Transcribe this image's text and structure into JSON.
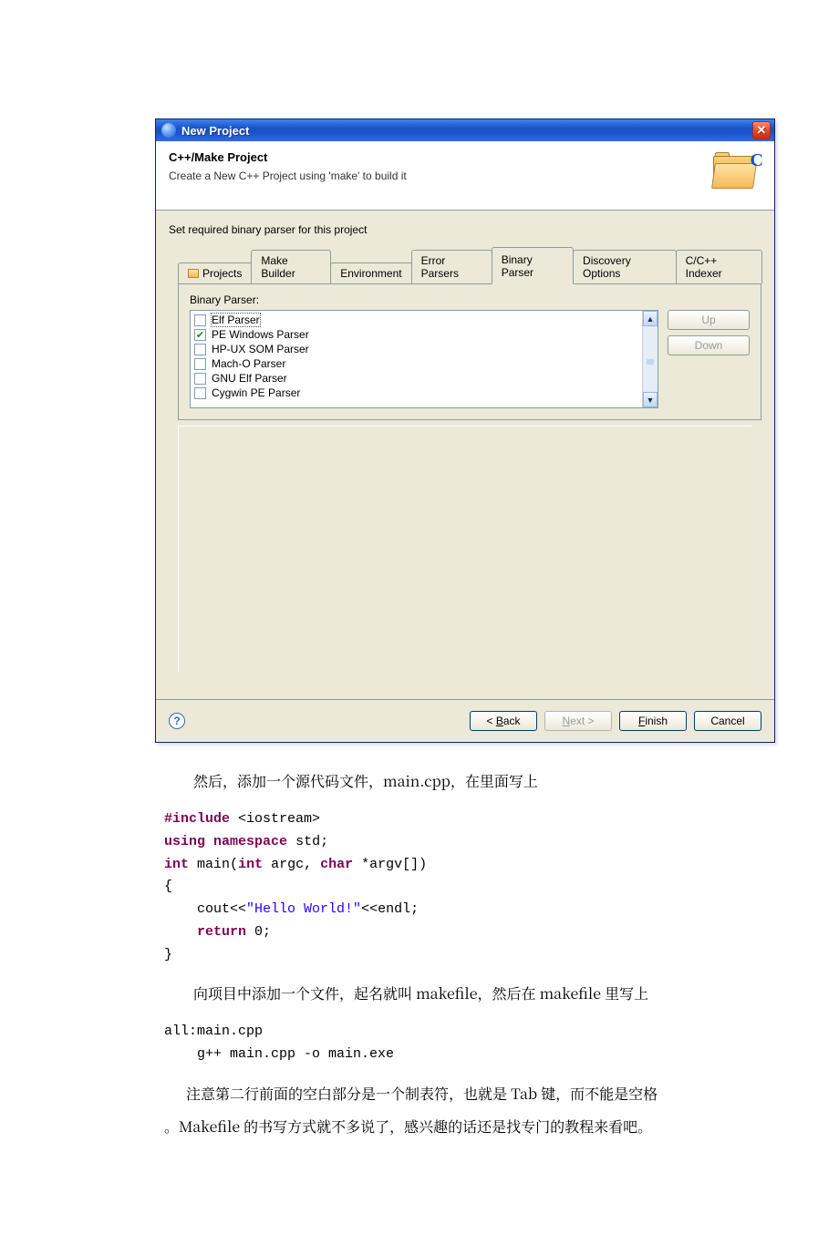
{
  "dialog": {
    "title": "New Project",
    "heading": "C++/Make Project",
    "subheading": "Create a New C++ Project using 'make' to build it",
    "section_label": "Set required binary parser for this project",
    "tabs": [
      "Projects",
      "Make Builder",
      "Environment",
      "Error Parsers",
      "Binary Parser",
      "Discovery Options",
      "C/C++ Indexer"
    ],
    "parser_label": "Binary Parser:",
    "parsers": [
      {
        "label": "Elf Parser",
        "checked": false,
        "selected": true
      },
      {
        "label": "PE Windows Parser",
        "checked": true
      },
      {
        "label": "HP-UX SOM Parser",
        "checked": false
      },
      {
        "label": "Mach-O Parser",
        "checked": false
      },
      {
        "label": "GNU Elf Parser",
        "checked": false
      },
      {
        "label": "Cygwin PE Parser",
        "checked": false
      }
    ],
    "buttons": {
      "up": "Up",
      "down": "Down",
      "back_u": "B",
      "back_rest": "ack",
      "next_u": "N",
      "next_rest": "ext",
      "finish_u": "F",
      "finish_rest": "inish",
      "cancel": "Cancel"
    }
  },
  "article": {
    "p1": "然后，添加一个源代码文件，main.cpp，在里面写上",
    "code": {
      "l1_kw": "#include",
      "l1_rest": "<iostream>",
      "l2_kw1": "using",
      "l2_kw2": "namespace",
      "l2_rest": "std;",
      "l3_kw1": "int",
      "l3_id": "main",
      "l3_kw2": "int",
      "l3_arg1": "argc",
      "l3_kw3": "char",
      "l3_arg2": "*argv[]",
      "l4": "{",
      "l5_a": "cout<<",
      "l5_str": "\"Hello World!\"",
      "l5_b": "<<endl;",
      "l6_kw": "return",
      "l6_rest": "0;",
      "l7": "}"
    },
    "p2": "向项目中添加一个文件，起名就叫 makefile，然后在 makefile 里写上",
    "make": {
      "l1": "all:main.cpp",
      "l2": "g++ main.cpp -o main.exe"
    },
    "p3a": "注意第二行前面的空白部分是一个制表符，也就是 Tab 键，而不能是空格",
    "p3b": "。Makefile 的书写方式就不多说了，感兴趣的话还是找专门的教程来看吧。"
  }
}
